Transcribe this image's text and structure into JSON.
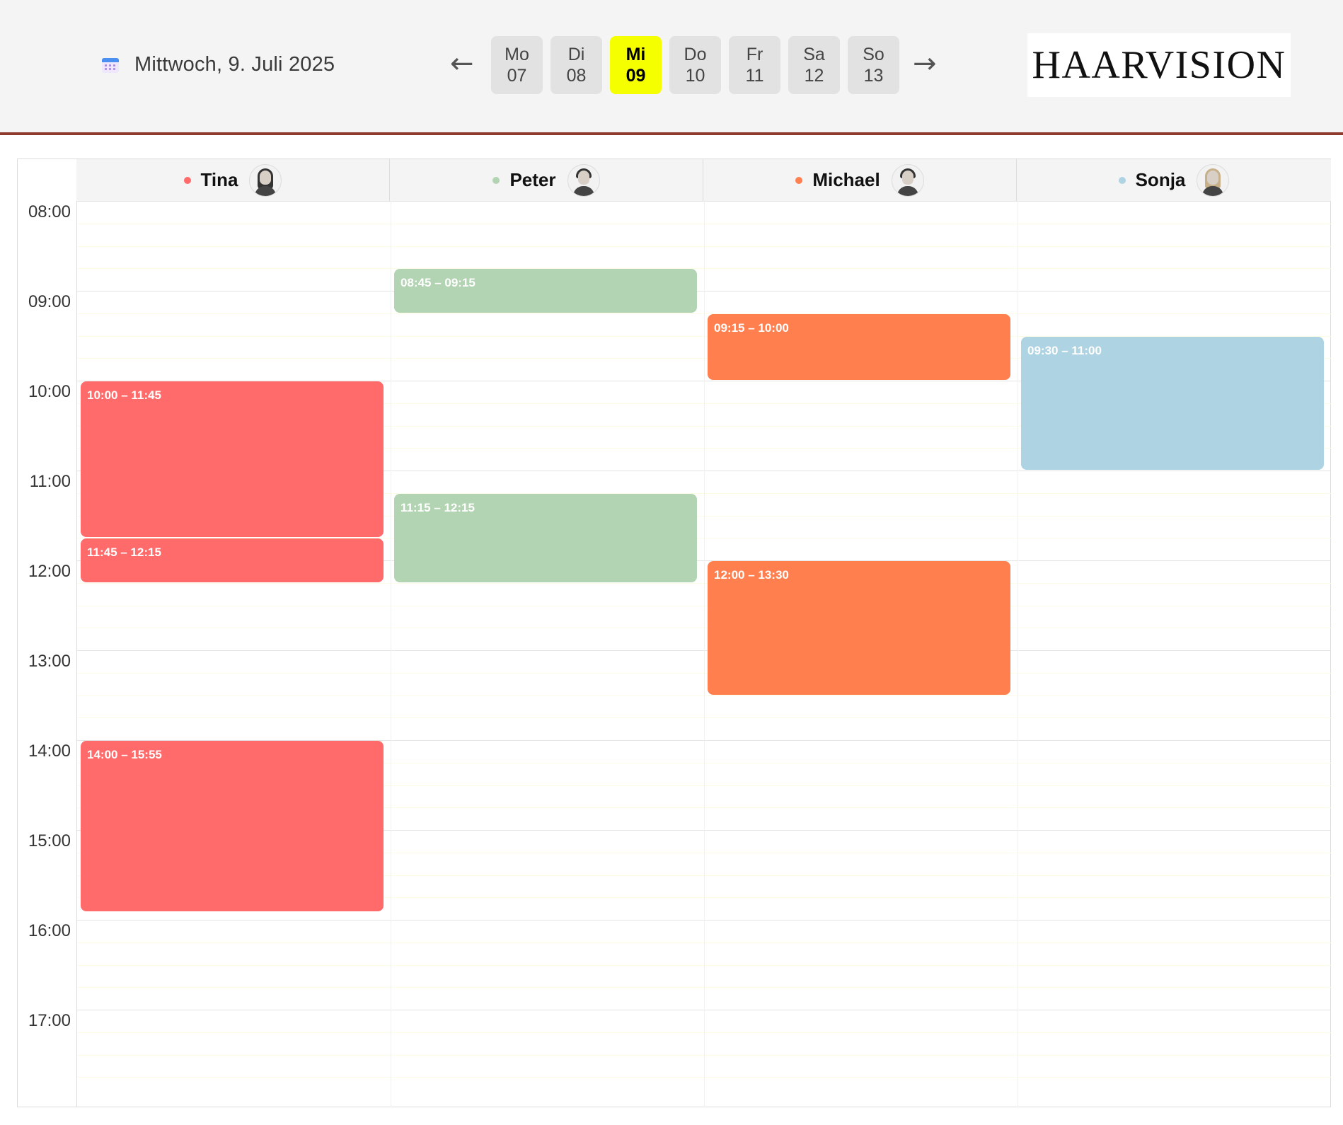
{
  "header": {
    "date_label": "Mittwoch, 9. Juli 2025",
    "prev_arrow": "←",
    "next_arrow": "→",
    "brand": "HAARVISION",
    "days": [
      {
        "dow": "Mo",
        "num": "07",
        "active": false
      },
      {
        "dow": "Di",
        "num": "08",
        "active": false
      },
      {
        "dow": "Mi",
        "num": "09",
        "active": true
      },
      {
        "dow": "Do",
        "num": "10",
        "active": false
      },
      {
        "dow": "Fr",
        "num": "11",
        "active": false
      },
      {
        "dow": "Sa",
        "num": "12",
        "active": false
      },
      {
        "dow": "So",
        "num": "13",
        "active": false
      }
    ]
  },
  "staff": [
    {
      "name": "Tina",
      "color": "#ff6b6b",
      "avatar_icon": "woman-avatar-icon"
    },
    {
      "name": "Peter",
      "color": "#b3d4b3",
      "avatar_icon": "man-avatar-icon"
    },
    {
      "name": "Michael",
      "color": "#ff7f4f",
      "avatar_icon": "man-avatar-icon"
    },
    {
      "name": "Sonja",
      "color": "#aed3e3",
      "avatar_icon": "woman-avatar-icon"
    }
  ],
  "hours": [
    "08:00",
    "09:00",
    "10:00",
    "11:00",
    "12:00",
    "13:00",
    "14:00",
    "15:00",
    "16:00",
    "17:00"
  ],
  "appointments": [
    {
      "staff": 0,
      "label": "10:00 – 11:45",
      "start": "10:00",
      "end": "11:45"
    },
    {
      "staff": 0,
      "label": "11:45 – 12:15",
      "start": "11:45",
      "end": "12:15"
    },
    {
      "staff": 0,
      "label": "14:00 – 15:55",
      "start": "14:00",
      "end": "15:55"
    },
    {
      "staff": 1,
      "label": "08:45 – 09:15",
      "start": "08:45",
      "end": "09:15"
    },
    {
      "staff": 1,
      "label": "11:15 – 12:15",
      "start": "11:15",
      "end": "12:15"
    },
    {
      "staff": 2,
      "label": "09:15 – 10:00",
      "start": "09:15",
      "end": "10:00"
    },
    {
      "staff": 2,
      "label": "12:00 – 13:30",
      "start": "12:00",
      "end": "13:30"
    },
    {
      "staff": 3,
      "label": "09:30 – 11:00",
      "start": "09:30",
      "end": "11:00"
    }
  ]
}
